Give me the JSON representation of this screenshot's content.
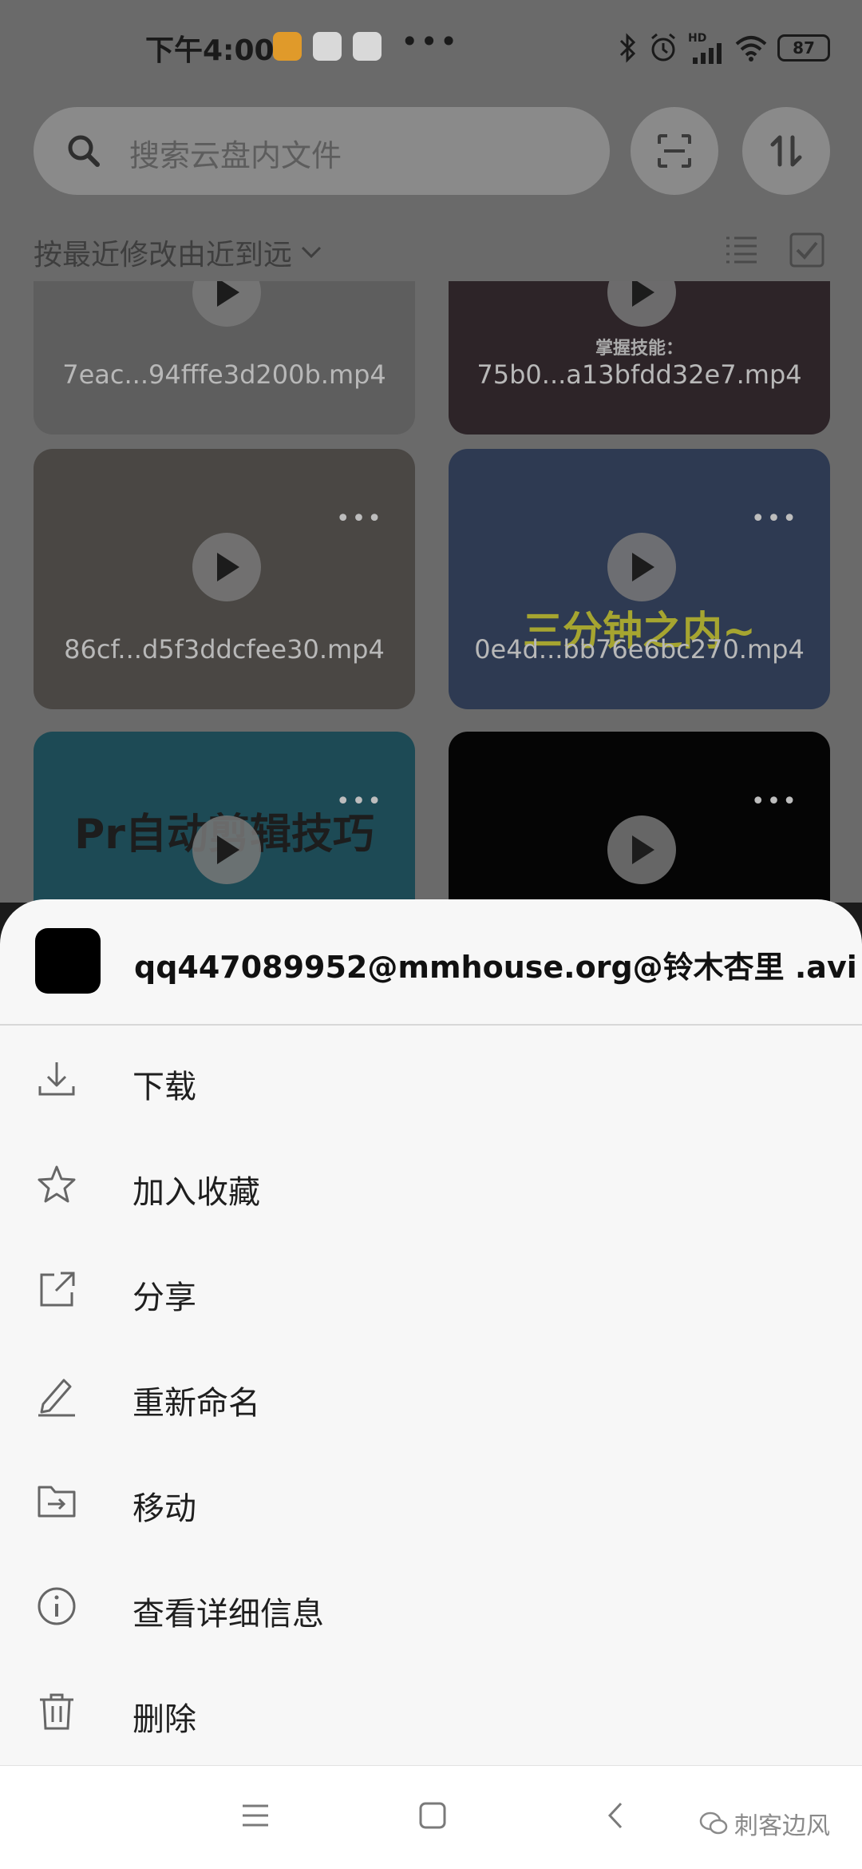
{
  "status_bar": {
    "time": "下午4:00",
    "battery": "87",
    "network": "HD"
  },
  "search": {
    "placeholder": "搜索云盘内文件"
  },
  "sort": {
    "label": "按最近修改由近到远"
  },
  "grid": {
    "tiles": [
      {
        "name": "7eac...94fffe3d200b.mp4",
        "overlay": ""
      },
      {
        "name": "75b0...a13bfdd32e7.mp4",
        "overlay": "掌握技能："
      },
      {
        "name": "86cf...d5f3ddcfee30.mp4",
        "overlay": ""
      },
      {
        "name": "0e4d...bb76e6bc270.mp4",
        "overlay": "三分钟之内~"
      },
      {
        "name": "",
        "overlay": "Pr自动剪辑技巧"
      },
      {
        "name": "",
        "overlay": ""
      }
    ]
  },
  "sheet": {
    "file_name": "qq447089952@mmhouse.org@铃木杏里 .avi",
    "actions": [
      {
        "label": "下载",
        "icon": "download-icon"
      },
      {
        "label": "加入收藏",
        "icon": "star-icon"
      },
      {
        "label": "分享",
        "icon": "share-icon"
      },
      {
        "label": "重新命名",
        "icon": "pencil-icon"
      },
      {
        "label": "移动",
        "icon": "move-folder-icon"
      },
      {
        "label": "查看详细信息",
        "icon": "info-icon"
      },
      {
        "label": "删除",
        "icon": "trash-icon"
      }
    ]
  },
  "watermark": {
    "text": "刺客边风"
  }
}
